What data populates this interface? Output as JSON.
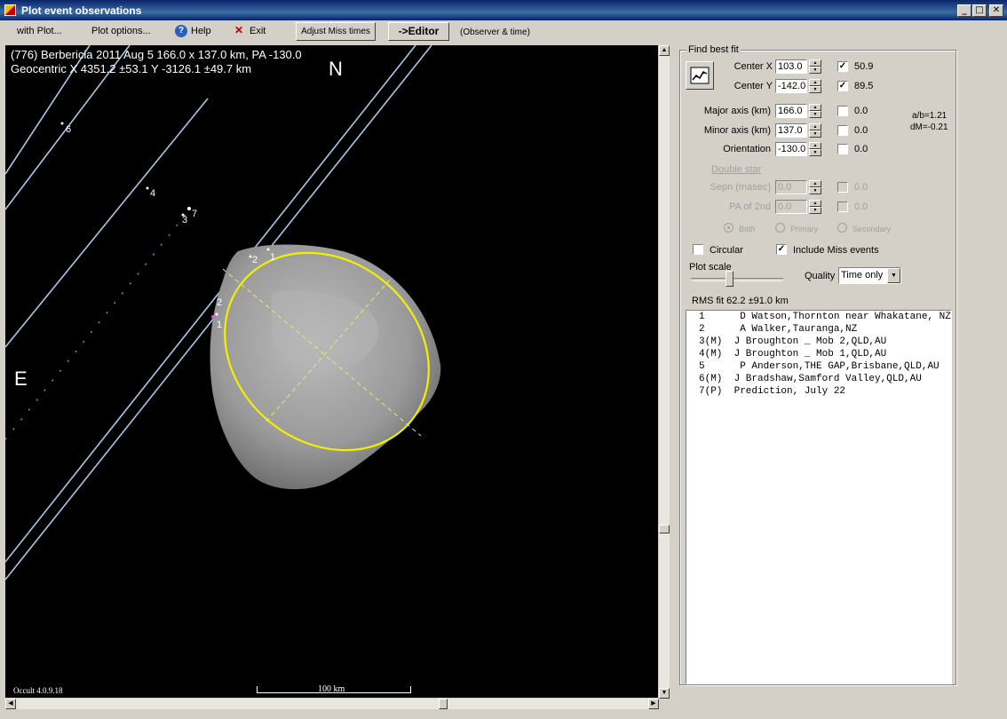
{
  "window": {
    "title": "Plot event observations"
  },
  "menu": {
    "with_plot": "with Plot...",
    "plot_options": "Plot options...",
    "help": "Help",
    "exit": "Exit",
    "adjust_miss": "Adjust Miss times",
    "editor": "->Editor",
    "observer_time": "(Observer & time)"
  },
  "plot": {
    "header_line1": "(776) Berbericia  2011 Aug 5   166.0 x 137.0 km, PA -130.0",
    "header_line2": "Geocentric  X  4351.2 ±53.1  Y -3126.1 ±49.7 km",
    "north": "N",
    "east": "E",
    "version": "Occult 4.0.9.18",
    "scale": "100 km",
    "chord_labels": [
      "6",
      "4",
      "3",
      "7",
      "2",
      "1",
      "2",
      "1"
    ]
  },
  "fit": {
    "group_title": "Find best fit",
    "fit_icon": "chart-fit-icon",
    "center_x": {
      "label": "Center X",
      "value": "103.0",
      "checked": true,
      "result": "50.9"
    },
    "center_y": {
      "label": "Center Y",
      "value": "-142.0",
      "checked": true,
      "result": "89.5"
    },
    "major": {
      "label": "Major axis (km)",
      "value": "166.0",
      "checked": false,
      "result": "0.0"
    },
    "minor": {
      "label": "Minor axis (km)",
      "value": "137.0",
      "checked": false,
      "result": "0.0"
    },
    "orient": {
      "label": "Orientation",
      "value": "-130.0",
      "checked": false,
      "result": "0.0"
    },
    "ab_ratio": "a/b=1.21",
    "dm": "dM=-0.21",
    "double_star": "Double star",
    "sepn": {
      "label": "Sepn (masec)",
      "value": "0.0",
      "result": "0.0"
    },
    "pa2": {
      "label": "PA of 2nd",
      "value": "0.0",
      "result": "0.0"
    },
    "radio_both": "Both",
    "radio_primary": "Primary",
    "radio_secondary": "Secondary",
    "circular": "Circular",
    "include_miss": "Include Miss events",
    "plot_scale": "Plot scale",
    "quality_label": "Quality",
    "quality_value": "Time only",
    "rms": "RMS fit 62.2 ±91.0 km"
  },
  "observers": [
    "1      D Watson,Thornton near Whakatane, NZ",
    "2      A Walker,Tauranga,NZ",
    "3(M)  J Broughton _ Mob 2,QLD,AU",
    "4(M)  J Broughton _ Mob 1,QLD,AU",
    "5      P Anderson,THE GAP,Brisbane,QLD,AU",
    "6(M)  J Bradshaw,Samford Valley,QLD,AU",
    "7(P)  Prediction, July 22"
  ],
  "colors": {
    "chord": "#a8c8e8",
    "ellipse": "#f0f000",
    "miss": "#d060d0"
  }
}
